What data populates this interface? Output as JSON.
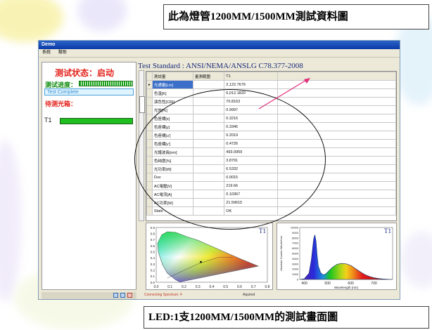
{
  "callouts": {
    "top": "此為燈管1200MM/1500MM測試資料圖",
    "bottom": "LED:1支1200MM/1500MM的測試畫面圖"
  },
  "window": {
    "title": "Demo",
    "menu": [
      "系統",
      "幫助"
    ]
  },
  "left_panel": {
    "status": "测试状态：启动",
    "progress_label": "测试进度：",
    "complete_text": "Test Complete",
    "pending_label": "待测光箱：",
    "channel_label": "T1"
  },
  "status_bar": {
    "connecting": "Connecting Spectrum: 4",
    "aquired": "Aquired"
  },
  "standard": "Test Standard : ANSI/NEMA/ANSLG C78.377-2008",
  "table": {
    "headers": [
      "測試量",
      "量測範圍",
      "T1"
    ],
    "rows": [
      [
        "光通量[Lm]",
        "",
        "2,122.7679"
      ],
      [
        "色溫[K]",
        "",
        "6,012.1820"
      ],
      [
        "演色性[CRI]",
        "",
        "70.8163"
      ],
      [
        "光效[%]",
        "",
        "0.9997"
      ],
      [
        "色座標[x]",
        "",
        "0.3216"
      ],
      [
        "色座標[y]",
        "",
        "0.3346"
      ],
      [
        "色座標[u']",
        "",
        "0.2019"
      ],
      [
        "色座標[v']",
        "",
        "0.4726"
      ],
      [
        "光譜波長[nm]",
        "",
        "493.0959"
      ],
      [
        "色純度[%]",
        "",
        "3.8791"
      ],
      [
        "光功率[W]",
        "",
        "6.5332"
      ],
      [
        "Duv",
        "",
        "0.0015"
      ],
      [
        "AC電壓[V]",
        "",
        "219.66"
      ],
      [
        "AC電流[A]",
        "",
        "0.10367"
      ],
      [
        "AC功率[W]",
        "",
        "21.59615"
      ],
      [
        "State :",
        "",
        "OK"
      ]
    ]
  },
  "chart_data": [
    {
      "type": "scatter",
      "label": "T1",
      "xlim": [
        0,
        0.8
      ],
      "ylim": [
        0,
        0.9
      ],
      "x_ticks": [
        "0.0",
        "0.1",
        "0.2",
        "0.3",
        "0.4",
        "0.5",
        "0.6",
        "0.7",
        "0.8"
      ],
      "y_ticks": [
        "0.0",
        "0.1",
        "0.2",
        "0.3",
        "0.4",
        "0.5",
        "0.6",
        "0.7",
        "0.8",
        "0.9"
      ],
      "x": [
        0.3216
      ],
      "y": [
        0.3346
      ]
    },
    {
      "type": "area",
      "label": "T1",
      "xlabel": "Wavelength (nm)",
      "ylabel": "Absolute Counts Wlm/m²nm",
      "xlim": [
        380,
        780
      ],
      "ylim": [
        0,
        10000
      ],
      "x_ticks": [
        "400",
        "500",
        "600",
        "700"
      ],
      "y_ticks": [
        "0",
        "1000",
        "2000",
        "3000",
        "4000",
        "5000",
        "6000",
        "7000",
        "8000",
        "9000",
        "10000"
      ],
      "x": [
        380,
        400,
        420,
        430,
        440,
        445,
        450,
        455,
        460,
        470,
        480,
        490,
        500,
        520,
        540,
        560,
        580,
        600,
        620,
        640,
        660,
        680,
        700,
        720,
        740,
        760,
        780
      ],
      "y": [
        0,
        150,
        1200,
        3800,
        7800,
        8600,
        7400,
        4600,
        2600,
        1300,
        900,
        1000,
        1400,
        2300,
        2900,
        3100,
        3000,
        2700,
        2100,
        1500,
        950,
        600,
        330,
        180,
        90,
        40,
        0
      ]
    }
  ]
}
